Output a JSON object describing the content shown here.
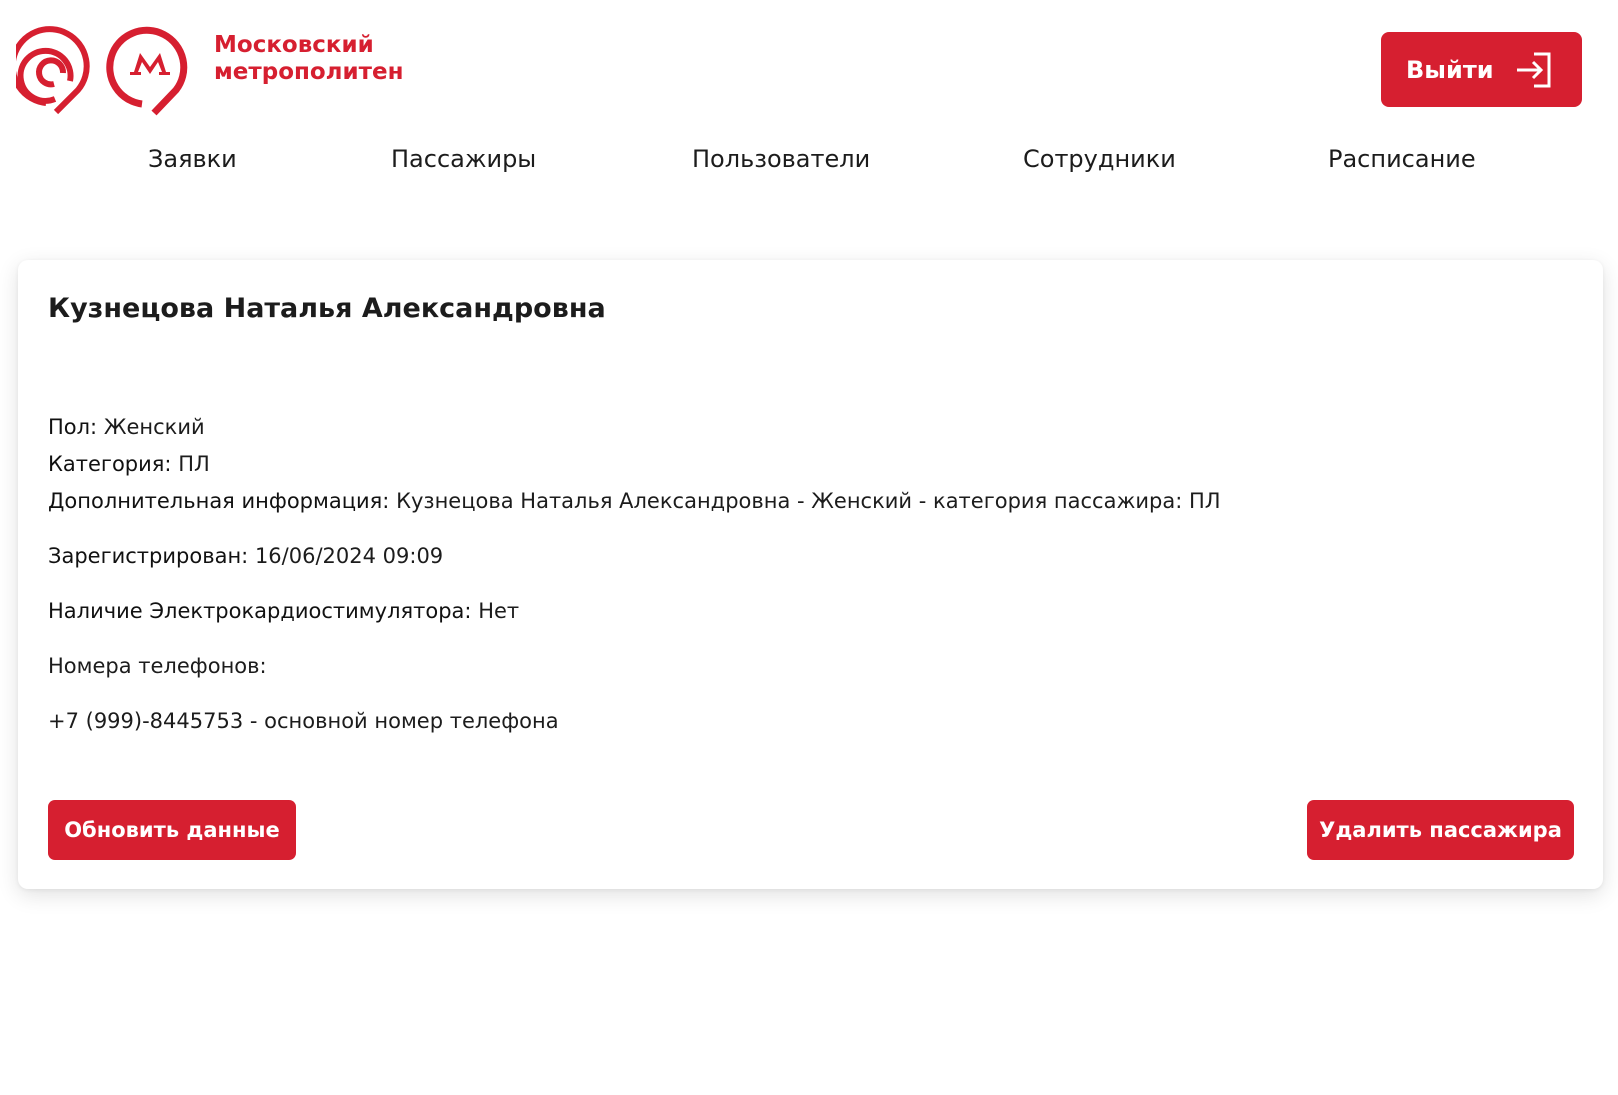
{
  "brand": {
    "line1": "Московский",
    "line2": "метрополитен",
    "color": "#d61f30"
  },
  "header": {
    "logout_label": "Выйти"
  },
  "nav": {
    "items": [
      {
        "label": "Заявки"
      },
      {
        "label": "Пассажиры"
      },
      {
        "label": "Пользователи"
      },
      {
        "label": "Сотрудники"
      },
      {
        "label": "Расписание"
      }
    ]
  },
  "passenger": {
    "name": "Кузнецова Наталья Александровна",
    "gender_label": "Пол:",
    "gender_value": "Женский",
    "category_label": "Категория:",
    "category_value": "ПЛ",
    "extra_label": "Дополнительная информация:",
    "extra_value": "Кузнецова Наталья Александровна - Женский - категория пассажира: ПЛ",
    "registered_label": "Зарегистрирован:",
    "registered_value": "16/06/2024 09:09",
    "pacemaker_label": "Наличие Электрокардиостимулятора:",
    "pacemaker_value": "Нет",
    "phones_label": "Номера телефонов:",
    "phones": [
      {
        "text": "+7 (999)-8445753 - основной номер телефона"
      }
    ]
  },
  "actions": {
    "update_label": "Обновить данные",
    "delete_label": "Удалить пассажира"
  },
  "icons": {
    "logo": "metro-logo-icon",
    "logout": "logout-arrow-icon"
  }
}
